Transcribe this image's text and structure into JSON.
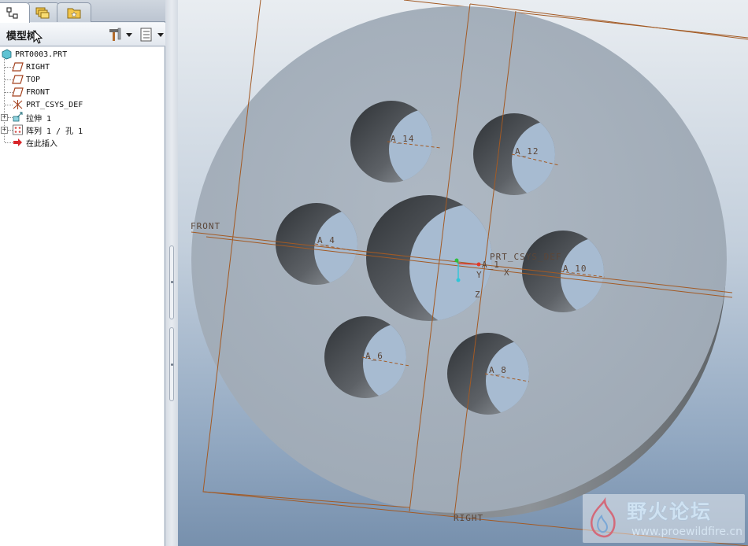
{
  "navigator": {
    "tabs": [
      {
        "name": "model-tree-tab-icon",
        "active": true
      },
      {
        "name": "folder-browser-tab-icon",
        "active": false
      },
      {
        "name": "favorites-tab-icon",
        "active": false
      }
    ],
    "title": "模型树",
    "settings_icon": "hammer-tools-icon",
    "show_icon": "list-view-icon"
  },
  "tree": {
    "items": [
      {
        "label": "PRT0003.PRT",
        "icon": "part-icon",
        "expandable": false
      },
      {
        "label": "RIGHT",
        "icon": "datum-plane-icon",
        "expandable": false
      },
      {
        "label": "TOP",
        "icon": "datum-plane-icon",
        "expandable": false
      },
      {
        "label": "FRONT",
        "icon": "datum-plane-icon",
        "expandable": false
      },
      {
        "label": "PRT_CSYS_DEF",
        "icon": "coordinate-system-icon",
        "expandable": false
      },
      {
        "label": "拉伸 1",
        "icon": "extrude-icon",
        "expandable": true
      },
      {
        "label": "阵列 1 / 孔 1",
        "icon": "pattern-icon",
        "expandable": true
      },
      {
        "label": "在此插入",
        "icon": "insert-here-arrow-icon",
        "expandable": false
      }
    ]
  },
  "viewport": {
    "datum_labels": {
      "front": "FRONT",
      "right": "RIGHT",
      "csys": "PRT_CSYS_DEF"
    },
    "axis_labels": [
      "A_14",
      "A_12",
      "A_4",
      "A_10",
      "A_6",
      "A_8",
      "A_1"
    ],
    "csys_axis_marks": [
      "X",
      "Y",
      "Z"
    ],
    "colors": {
      "part_face": "#a8b3bf",
      "datum_line": "#a35a24",
      "csys_green": "#2fbf3f",
      "csys_red": "#e23a2a",
      "csys_cyan": "#2fc6d8"
    }
  },
  "watermark": {
    "title": "野火论坛",
    "url": "www.proewildfire.cn"
  }
}
